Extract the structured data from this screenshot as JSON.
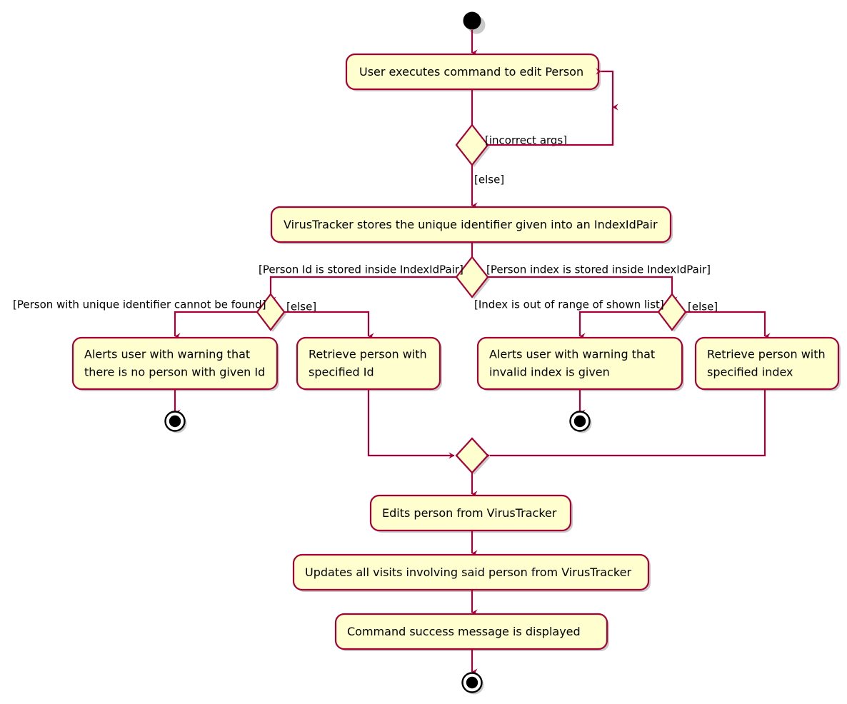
{
  "diagram": {
    "type": "uml-activity-diagram",
    "title": "Edit Person activity diagram",
    "colors": {
      "node_fill": "#FEFECE",
      "node_border": "#A80036",
      "edge": "#A80036",
      "text": "#000000",
      "background": "#FFFFFF",
      "terminator": "#000000"
    },
    "nodes": [
      {
        "id": "start",
        "kind": "initial-node",
        "label": ""
      },
      {
        "id": "a_user_exec",
        "kind": "activity",
        "label": "User executes command to edit Person"
      },
      {
        "id": "d_args",
        "kind": "decision",
        "label": ""
      },
      {
        "id": "a_store_pair",
        "kind": "activity",
        "label": "VirusTracker stores the unique identifier given into an IndexIdPair"
      },
      {
        "id": "d_pair_kind",
        "kind": "decision",
        "label": ""
      },
      {
        "id": "d_id_found",
        "kind": "decision",
        "label": ""
      },
      {
        "id": "d_index_range",
        "kind": "decision",
        "label": ""
      },
      {
        "id": "a_alert_no_person",
        "kind": "activity",
        "label": "Alerts user with warning that\nthere is no person with given Id"
      },
      {
        "id": "a_retrieve_id",
        "kind": "activity",
        "label": "Retrieve person with\nspecified Id"
      },
      {
        "id": "a_alert_bad_index",
        "kind": "activity",
        "label": "Alerts user with warning that\ninvalid index is given"
      },
      {
        "id": "a_retrieve_index",
        "kind": "activity",
        "label": "Retrieve person with\nspecified index"
      },
      {
        "id": "end_no_person",
        "kind": "final-node",
        "label": ""
      },
      {
        "id": "end_bad_index",
        "kind": "final-node",
        "label": ""
      },
      {
        "id": "merge",
        "kind": "merge",
        "label": ""
      },
      {
        "id": "a_edit_person",
        "kind": "activity",
        "label": "Edits person from VirusTracker"
      },
      {
        "id": "a_update_visits",
        "kind": "activity",
        "label": "Updates all visits involving said person from VirusTracker"
      },
      {
        "id": "a_success_msg",
        "kind": "activity",
        "label": "Command success message is displayed"
      },
      {
        "id": "end_success",
        "kind": "final-node",
        "label": ""
      }
    ],
    "activities": {
      "user_executes": "User executes command to edit Person",
      "stores_pair": "VirusTracker stores the unique identifier given into an IndexIdPair",
      "alert_no_person_line1": "Alerts user with warning that",
      "alert_no_person_line2": "there is no person with given Id",
      "retrieve_id_line1": "Retrieve person with",
      "retrieve_id_line2": "specified Id",
      "alert_bad_index_line1": "Alerts user with warning that",
      "alert_bad_index_line2": "invalid index is given",
      "retrieve_index_line1": "Retrieve person with",
      "retrieve_index_line2": "specified index",
      "edits_person": "Edits person from VirusTracker",
      "updates_visits": "Updates all visits involving said person from VirusTracker",
      "success_message": "Command success message is displayed"
    },
    "guards": {
      "incorrect_args": "[incorrect args]",
      "else_args": "[else]",
      "person_id_stored": "[Person Id is stored inside IndexIdPair]",
      "person_index_stored": "[Person index is stored inside IndexIdPair]",
      "person_not_found": "[Person with unique identifier cannot be found]",
      "else_id": "[else]",
      "index_out_of_range": "[Index is out of range of shown list]",
      "else_index": "[else]"
    }
  }
}
